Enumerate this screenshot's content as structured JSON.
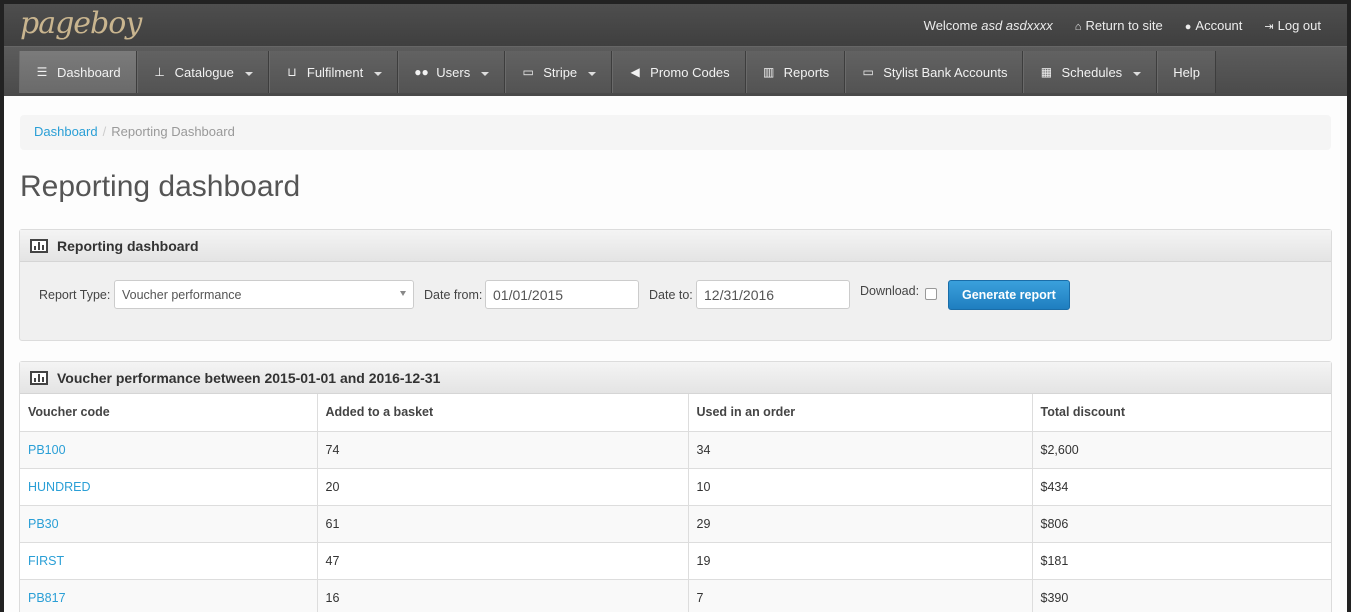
{
  "header": {
    "logo": "pageboy",
    "welcome_prefix": "Welcome",
    "welcome_user": "asd asdxxxx",
    "return_label": "Return to site",
    "account_label": "Account",
    "logout_label": "Log out"
  },
  "nav": {
    "items": [
      {
        "label": "Dashboard",
        "icon": "list-icon"
      },
      {
        "label": "Catalogue",
        "icon": "sitemap-icon"
      },
      {
        "label": "Fulfilment",
        "icon": "cart-icon"
      },
      {
        "label": "Users",
        "icon": "users-icon"
      },
      {
        "label": "Stripe",
        "icon": "card-icon"
      },
      {
        "label": "Promo Codes",
        "icon": "megaphone-icon"
      },
      {
        "label": "Reports",
        "icon": "bar-chart-icon"
      },
      {
        "label": "Stylist Bank Accounts",
        "icon": "card-icon"
      },
      {
        "label": "Schedules",
        "icon": "calendar-icon"
      },
      {
        "label": "Help",
        "icon": ""
      }
    ]
  },
  "breadcrumb": {
    "home": "Dashboard",
    "current": "Reporting Dashboard"
  },
  "page_title": "Reporting dashboard",
  "filter_panel": {
    "title": "Reporting dashboard",
    "report_type_label": "Report Type:",
    "report_type_value": "Voucher performance",
    "date_from_label": "Date from:",
    "date_from_value": "01/01/2015",
    "date_to_label": "Date to:",
    "date_to_value": "12/31/2016",
    "download_label": "Download:",
    "generate_label": "Generate report"
  },
  "results_panel": {
    "title": "Voucher performance between 2015-01-01 and 2016-12-31",
    "columns": [
      "Voucher code",
      "Added to a basket",
      "Used in an order",
      "Total discount"
    ],
    "rows": [
      [
        "PB100",
        "74",
        "34",
        "$2,600"
      ],
      [
        "HUNDRED",
        "20",
        "10",
        "$434"
      ],
      [
        "PB30",
        "61",
        "29",
        "$806"
      ],
      [
        "FIRST",
        "47",
        "19",
        "$181"
      ],
      [
        "PB817",
        "16",
        "7",
        "$390"
      ]
    ]
  },
  "colors": {
    "accent": "#2a9fd6",
    "button": "#2a88cb",
    "nav": "#555555"
  }
}
